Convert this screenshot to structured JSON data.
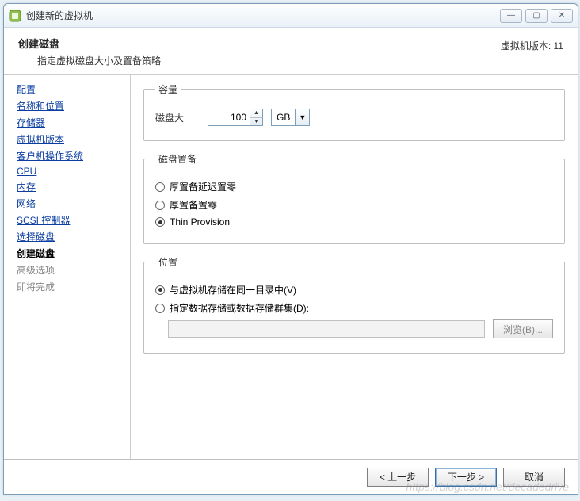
{
  "window": {
    "title": "创建新的虚拟机"
  },
  "header": {
    "title": "创建磁盘",
    "subtitle": "指定虚拟磁盘大小及置备策略",
    "version_label": "虚拟机版本: 11"
  },
  "sidebar": {
    "items": [
      {
        "label": "配置",
        "state": "link"
      },
      {
        "label": "名称和位置",
        "state": "link"
      },
      {
        "label": "存储器",
        "state": "link"
      },
      {
        "label": "虚拟机版本",
        "state": "link"
      },
      {
        "label": "客户机操作系统",
        "state": "link"
      },
      {
        "label": "CPU",
        "state": "link"
      },
      {
        "label": "内存",
        "state": "link"
      },
      {
        "label": "网络",
        "state": "link"
      },
      {
        "label": "SCSI 控制器",
        "state": "link"
      },
      {
        "label": "选择磁盘",
        "state": "link"
      },
      {
        "label": "创建磁盘",
        "state": "current"
      },
      {
        "label": "高级选项",
        "state": "disabled"
      },
      {
        "label": "即将完成",
        "state": "disabled"
      }
    ]
  },
  "capacity": {
    "legend": "容量",
    "size_label": "磁盘大",
    "size_value": "100",
    "unit": "GB"
  },
  "provisioning": {
    "legend": "磁盘置备",
    "options": [
      {
        "label": "厚置备延迟置零",
        "checked": false
      },
      {
        "label": "厚置备置零",
        "checked": false
      },
      {
        "label": "Thin Provision",
        "checked": true
      }
    ]
  },
  "location": {
    "legend": "位置",
    "options": [
      {
        "label": "与虚拟机存储在同一目录中(V)",
        "checked": true
      },
      {
        "label": "指定数据存储或数据存储群集(D):",
        "checked": false
      }
    ],
    "path_value": "",
    "browse_label": "浏览(B)..."
  },
  "footer": {
    "back": "< 上一步",
    "next": "下一步 >",
    "cancel": "取消"
  },
  "watermark": "https://blog.csdn.net/decadedrive"
}
